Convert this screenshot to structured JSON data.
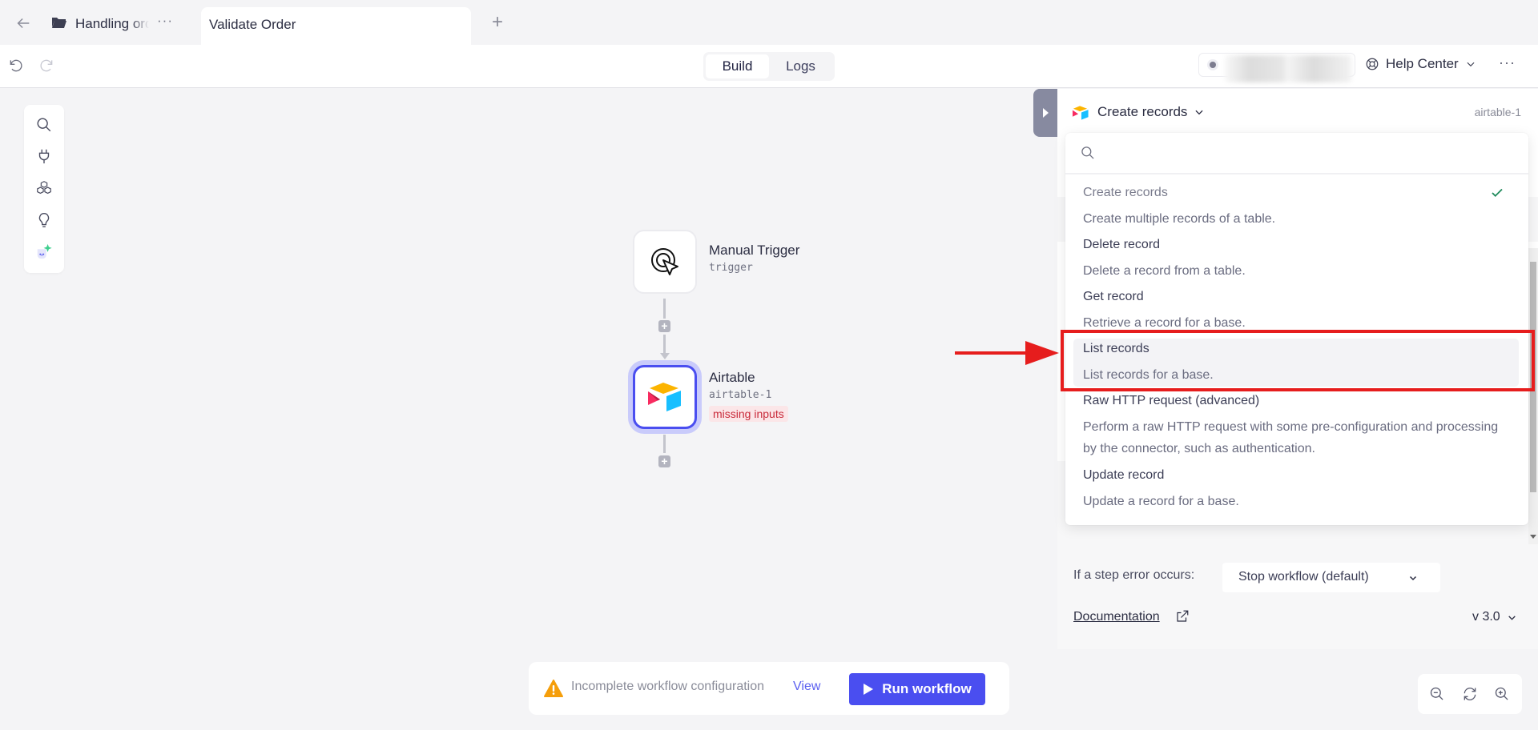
{
  "tabbar": {
    "project_name": "Handling orders",
    "active_tab": "Validate Order",
    "more": "···",
    "add": "+"
  },
  "toolbar": {
    "modes": [
      {
        "label": "Build",
        "active": true
      },
      {
        "label": "Logs",
        "active": false
      }
    ],
    "help_label": "Help Center",
    "more": "···"
  },
  "rail": {
    "icons": [
      "search-icon",
      "plug-icon",
      "blocks-icon",
      "lightbulb-icon",
      "ai-assistant-icon"
    ]
  },
  "canvas": {
    "nodes": [
      {
        "title": "Manual Trigger",
        "subtitle": "trigger",
        "icon": "cursor-click-icon"
      },
      {
        "title": "Airtable",
        "subtitle": "airtable-1",
        "badge": "missing inputs",
        "icon": "airtable-logo",
        "selected": true
      }
    ]
  },
  "panel": {
    "action_label": "Create records",
    "step_id": "airtable-1",
    "search_placeholder": "",
    "options": [
      {
        "title": "Create records",
        "desc": "Create multiple records of a table.",
        "selected": true
      },
      {
        "title": "Delete record",
        "desc": "Delete a record from a table."
      },
      {
        "title": "Get record",
        "desc": "Retrieve a record for a base."
      },
      {
        "title": "List records",
        "desc": "List records for a base.",
        "highlighted": true
      },
      {
        "title": "Raw HTTP request (advanced)",
        "desc": "Perform a raw HTTP request with some pre-configuration and processing by the connector, such as authentication."
      },
      {
        "title": "Update record",
        "desc": "Update a record for a base."
      }
    ],
    "error_label": "If a step error occurs:",
    "error_option": "Stop workflow (default)",
    "doc_link": "Documentation",
    "version": "v 3.0"
  },
  "runbar": {
    "message": "Incomplete workflow configuration",
    "view_label": "View",
    "run_label": "Run workflow"
  },
  "colors": {
    "accent": "#4a4ef0",
    "annotation": "#e61d1d",
    "warning": "#f59e0b",
    "check": "#1f8a5b",
    "error_badge_text": "#c92a3a"
  }
}
